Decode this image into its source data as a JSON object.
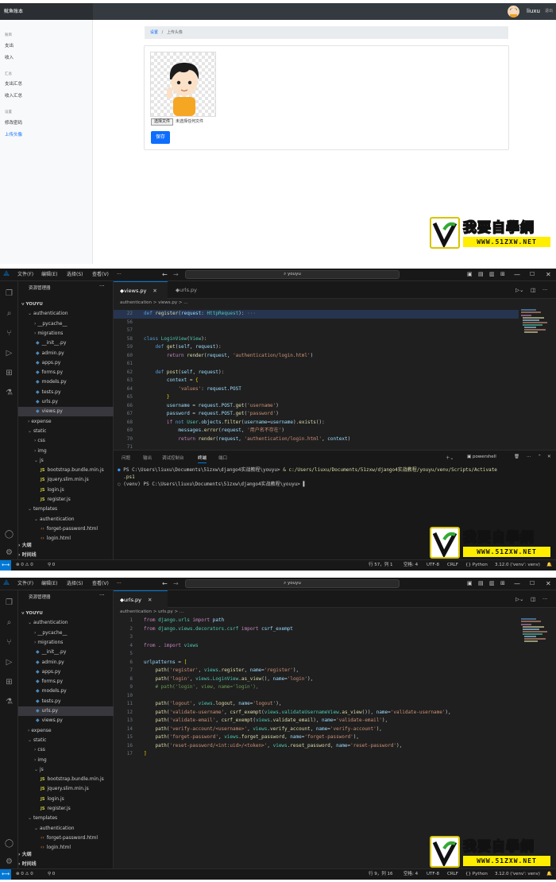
{
  "webapp": {
    "brand": "鱿鱼账本",
    "username": "liuxu",
    "logout": "退出",
    "sidebar": {
      "sec1": "账目",
      "item_expense": "支出",
      "item_income": "收入",
      "sec2": "汇总",
      "item_expense_sum": "支出汇总",
      "item_income_sum": "收入汇总",
      "sec3": "设置",
      "item_change_pwd": "修改密码",
      "item_avatar": "上传头像"
    },
    "breadcrumb": {
      "link": "设置",
      "sep": "/",
      "current": "上传头像"
    },
    "file_button": "选择文件",
    "file_status": "未选择任何文件",
    "save_button": "保存"
  },
  "watermark": {
    "title": "我要自學網",
    "url": "WWW.51ZXW.NET"
  },
  "vscode": {
    "menu": [
      "文件(F)",
      "编辑(E)",
      "选择(S)",
      "查看(V)",
      "···"
    ],
    "search": "youyu",
    "explorer_title": "资源管理器",
    "root": "YOUYU",
    "tree": {
      "authentication": "authentication",
      "pycache": "__pycache__",
      "migrations": "migrations",
      "init": "__init__.py",
      "admin": "admin.py",
      "apps": "apps.py",
      "forms": "forms.py",
      "models": "models.py",
      "tests": "tests.py",
      "urls": "urls.py",
      "views": "views.py",
      "expense": "expense",
      "static": "static",
      "css": "css",
      "img": "img",
      "js": "js",
      "bootstrap": "bootstrap.bundle.min.js",
      "jquery": "jquery.slim.min.js",
      "login_js": "login.js",
      "register_js": "register.js",
      "templates": "templates",
      "t_auth": "authentication",
      "forget": "forget-password.html",
      "login_html": "login.html"
    },
    "outline": "大纲",
    "timeline": "时间线",
    "panel_tabs": [
      "问题",
      "输出",
      "调试控制台",
      "终端",
      "端口"
    ],
    "terminal_shell": "powershell",
    "editor1": {
      "tabs": [
        "views.py",
        "urls.py"
      ],
      "breadcrumb": "authentication > views.py > ...",
      "lines": [
        {
          "n": "22",
          "html": "<span class=\"kw\">def</span> <span class=\"fn\">register</span>(<span class=\"var\">request</span>: <span class=\"cls\">HttpRequest</span>): <span style=\"color:#888\">···</span>"
        },
        {
          "n": "56",
          "html": ""
        },
        {
          "n": "57",
          "html": ""
        },
        {
          "n": "58",
          "html": "<span class=\"kw\">class</span> <span class=\"cls\">LoginView</span>(<span class=\"cls\">View</span>):"
        },
        {
          "n": "59",
          "html": "    <span class=\"kw\">def</span> <span class=\"fn\">get</span>(<span class=\"var\">self</span>, <span class=\"var\">request</span>):"
        },
        {
          "n": "60",
          "html": "        <span class=\"kw2\">return</span> <span class=\"fn\">render</span>(<span class=\"var\">request</span>, <span class=\"str\">'authentication/login.html'</span>)"
        },
        {
          "n": "61",
          "html": ""
        },
        {
          "n": "62",
          "html": "    <span class=\"kw\">def</span> <span class=\"fn\">post</span>(<span class=\"var\">self</span>, <span class=\"var\">request</span>):"
        },
        {
          "n": "63",
          "html": "        <span class=\"var\">context</span> = <span class=\"yl\">{</span>"
        },
        {
          "n": "64",
          "html": "            <span class=\"str\">'values'</span>: <span class=\"var\">request</span>.<span class=\"var\">POST</span>"
        },
        {
          "n": "65",
          "html": "        <span class=\"yl\">}</span>"
        },
        {
          "n": "66",
          "html": "        <span class=\"var\">username</span> = <span class=\"var\">request</span>.<span class=\"var\">POST</span>.<span class=\"fn\">get</span>(<span class=\"str\">'username'</span>)"
        },
        {
          "n": "67",
          "html": "        <span class=\"var\">password</span> = <span class=\"var\">request</span>.<span class=\"var\">POST</span>.<span class=\"fn\">get</span>(<span class=\"str\">'password'</span>)"
        },
        {
          "n": "68",
          "html": "        <span class=\"kw2\">if</span> <span class=\"kw\">not</span> <span class=\"cls\">User</span>.<span class=\"var\">objects</span>.<span class=\"fn\">filter</span>(<span class=\"var\">username</span>=<span class=\"var\">username</span>).<span class=\"fn\">exists</span>():"
        },
        {
          "n": "69",
          "html": "            <span class=\"var\">messages</span>.<span class=\"fn\">error</span>(<span class=\"var\">request</span>, <span class=\"str\">'用户名不存在'</span>)"
        },
        {
          "n": "70",
          "html": "            <span class=\"kw2\">return</span> <span class=\"fn\">render</span>(<span class=\"var\">request</span>, <span class=\"str\">'authentication/login.html'</span>, <span class=\"var\">context</span>)"
        },
        {
          "n": "71",
          "html": ""
        }
      ],
      "terminal": [
        "<span style=\"color:#3794ff\">●</span> PS C:\\Users\\liuxu\\Documents\\51zxw\\django4实战教程\\youyu> <span class=\"fn\">&</span> <span class=\"fn\">c:/Users/liuxu/Documents/51zxw/django4实战教程/youyu/venv/Scripts/Activate</span>",
        "  <span class=\"fn\">.ps1</span>",
        "<span style=\"color:#888\">○</span> (venv) PS C:\\Users\\liuxu\\Documents\\51zxw\\django4实战教程\\youyu> ▌"
      ],
      "status": {
        "errors": "⊗ 0 ⚠ 0",
        "ports": "⚲ 0",
        "position": "行 57，列 1",
        "spaces": "空格: 4",
        "encoding": "UTF-8",
        "eol": "CRLF",
        "lang": "{} Python",
        "version": "3.12.0 ('venv': venv)"
      }
    },
    "editor2": {
      "tabs": [
        "urls.py"
      ],
      "breadcrumb": "authentication > urls.py > ...",
      "lines": [
        {
          "n": "1",
          "html": "<span class=\"kw2\">from</span> <span class=\"cls\">django.urls</span> <span class=\"kw2\">import</span> <span class=\"var\">path</span>"
        },
        {
          "n": "2",
          "html": "<span class=\"kw2\">from</span> <span class=\"cls\">django.views.decorators.csrf</span> <span class=\"kw2\">import</span> <span class=\"var\">csrf_exempt</span>"
        },
        {
          "n": "3",
          "html": ""
        },
        {
          "n": "4",
          "html": "<span class=\"kw2\">from</span> . <span class=\"kw2\">import</span> <span class=\"cls\">views</span>"
        },
        {
          "n": "5",
          "html": ""
        },
        {
          "n": "6",
          "html": "<span class=\"var\">urlpatterns</span> = <span class=\"yl\">[</span>"
        },
        {
          "n": "7",
          "html": "    <span class=\"fn\">path</span>(<span class=\"str\">'register'</span>, <span class=\"cls\">views</span>.<span class=\"fn\">register</span>, <span class=\"var\">name</span>=<span class=\"str\">'register'</span>),"
        },
        {
          "n": "8",
          "html": "    <span class=\"fn\">path</span>(<span class=\"str\">'login'</span>, <span class=\"cls\">views</span>.<span class=\"cls\">LoginView</span>.<span class=\"fn\">as_view</span>(), <span class=\"var\">name</span>=<span class=\"str\">'login'</span>),"
        },
        {
          "n": "9",
          "html": "    <span class=\"cm\"># path('login', view, name='login'),</span>"
        },
        {
          "n": "10",
          "html": ""
        },
        {
          "n": "11",
          "html": "    <span class=\"fn\">path</span>(<span class=\"str\">'logout'</span>, <span class=\"cls\">views</span>.<span class=\"fn\">logout</span>, <span class=\"var\">name</span>=<span class=\"str\">'logout'</span>),"
        },
        {
          "n": "12",
          "html": "    <span class=\"fn\">path</span>(<span class=\"str\">'validate-username'</span>, <span class=\"fn\">csrf_exempt</span>(<span class=\"cls\">views</span>.<span class=\"cls\">validateUsernameView</span>.<span class=\"fn\">as_view</span>()), <span class=\"var\">name</span>=<span class=\"str\">'validate-username'</span>),"
        },
        {
          "n": "13",
          "html": "    <span class=\"fn\">path</span>(<span class=\"str\">'validate-email'</span>, <span class=\"fn\">csrf_exempt</span>(<span class=\"cls\">views</span>.<span class=\"fn\">validate_email</span>), <span class=\"var\">name</span>=<span class=\"str\">'validate-email'</span>),"
        },
        {
          "n": "14",
          "html": "    <span class=\"fn\">path</span>(<span class=\"str\">'verify-account/&lt;username&gt;'</span>, <span class=\"cls\">views</span>.<span class=\"fn\">verify_account</span>, <span class=\"var\">name</span>=<span class=\"str\">'verify-account'</span>),"
        },
        {
          "n": "15",
          "html": "    <span class=\"fn\">path</span>(<span class=\"str\">'forget-password'</span>, <span class=\"cls\">views</span>.<span class=\"fn\">forget_password</span>, <span class=\"var\">name</span>=<span class=\"str\">'forget-password'</span>),"
        },
        {
          "n": "16",
          "html": "    <span class=\"fn\">path</span>(<span class=\"str\">'reset-password/&lt;int:uid&gt;/&lt;token&gt;'</span>, <span class=\"cls\">views</span>.<span class=\"fn\">reset_password</span>, <span class=\"var\">name</span>=<span class=\"str\">'reset-password'</span>),"
        },
        {
          "n": "17",
          "html": "<span class=\"yl\">]</span>"
        }
      ],
      "status": {
        "errors": "⊗ 0 ⚠ 0",
        "ports": "⚲ 0",
        "position": "行 9，列 16",
        "spaces": "空格: 4",
        "encoding": "UTF-8",
        "eol": "CRLF",
        "lang": "{} Python",
        "version": "3.12.0 ('venv': venv)"
      }
    }
  },
  "colors": {
    "accent": "#0d6efd",
    "vscode_blue": "#0078d4",
    "watermark_yellow": "#ffee00"
  }
}
